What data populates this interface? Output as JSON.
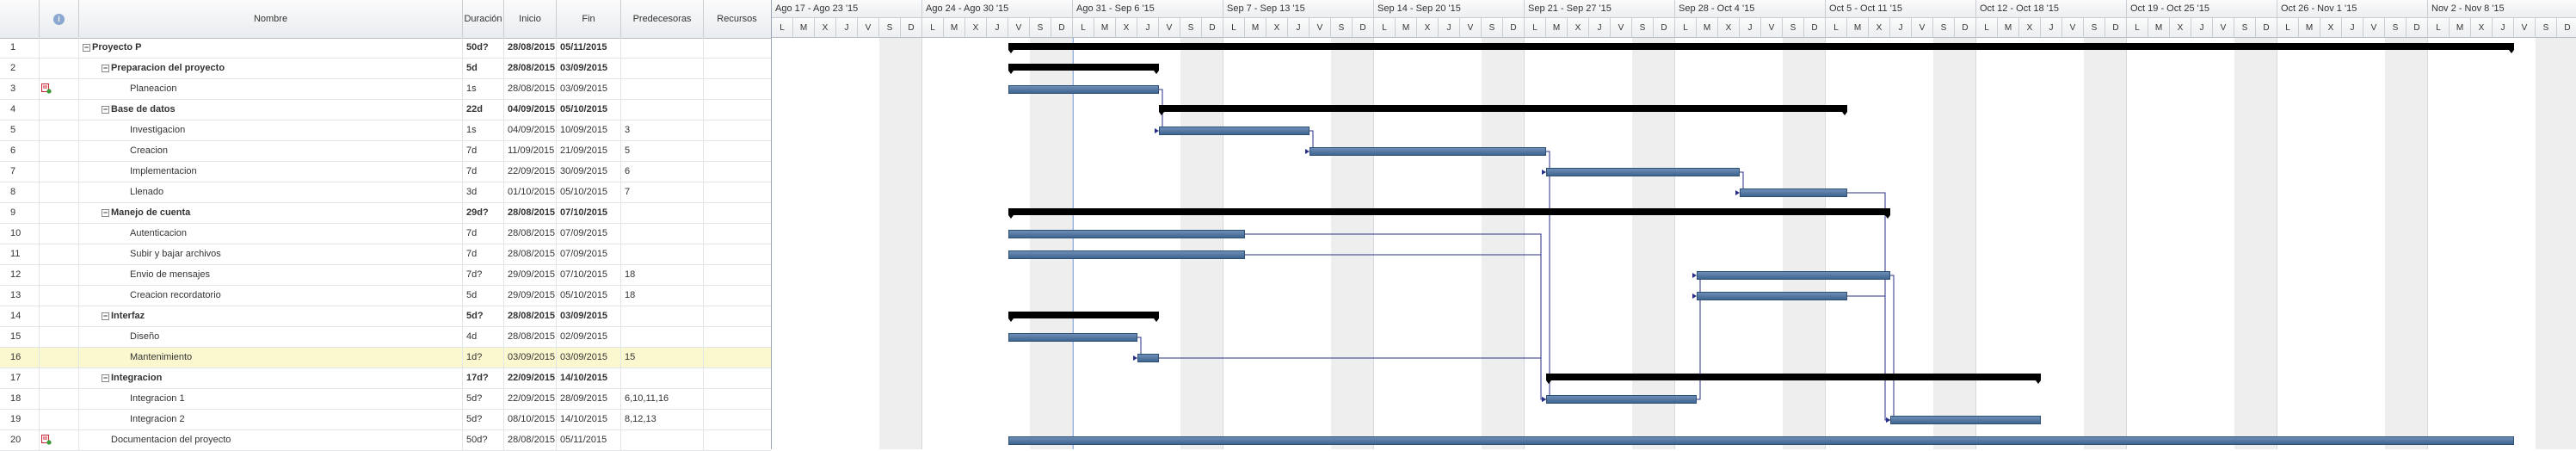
{
  "columns": {
    "info": "i",
    "name": "Nombre",
    "duration": "Duración",
    "start": "Inicio",
    "finish": "Fin",
    "predecessors": "Predecesoras",
    "resources": "Recursos"
  },
  "tasks": [
    {
      "id": "1",
      "name": "Proyecto P",
      "dur": "50d?",
      "start": "28/08/2015",
      "end": "05/11/2015",
      "pred": "",
      "res": "",
      "bold": true,
      "level": 0,
      "toggle": "⊟",
      "icon": ""
    },
    {
      "id": "2",
      "name": "Preparacion del proyecto",
      "dur": "5d",
      "start": "28/08/2015",
      "end": "03/09/2015",
      "pred": "",
      "res": "",
      "bold": true,
      "level": 1,
      "toggle": "⊟",
      "icon": ""
    },
    {
      "id": "3",
      "name": "Planeacion",
      "dur": "1s",
      "start": "28/08/2015",
      "end": "03/09/2015",
      "pred": "",
      "res": "",
      "bold": false,
      "level": 2,
      "toggle": "",
      "icon": "note"
    },
    {
      "id": "4",
      "name": "Base de datos",
      "dur": "22d",
      "start": "04/09/2015",
      "end": "05/10/2015",
      "pred": "",
      "res": "",
      "bold": true,
      "level": 1,
      "toggle": "⊟",
      "icon": ""
    },
    {
      "id": "5",
      "name": "Investigacion",
      "dur": "1s",
      "start": "04/09/2015",
      "end": "10/09/2015",
      "pred": "3",
      "res": "",
      "bold": false,
      "level": 2,
      "toggle": "",
      "icon": ""
    },
    {
      "id": "6",
      "name": "Creacion",
      "dur": "7d",
      "start": "11/09/2015",
      "end": "21/09/2015",
      "pred": "5",
      "res": "",
      "bold": false,
      "level": 2,
      "toggle": "",
      "icon": ""
    },
    {
      "id": "7",
      "name": "Implementacion",
      "dur": "7d",
      "start": "22/09/2015",
      "end": "30/09/2015",
      "pred": "6",
      "res": "",
      "bold": false,
      "level": 2,
      "toggle": "",
      "icon": ""
    },
    {
      "id": "8",
      "name": "Llenado",
      "dur": "3d",
      "start": "01/10/2015",
      "end": "05/10/2015",
      "pred": "7",
      "res": "",
      "bold": false,
      "level": 2,
      "toggle": "",
      "icon": ""
    },
    {
      "id": "9",
      "name": "Manejo de cuenta",
      "dur": "29d?",
      "start": "28/08/2015",
      "end": "07/10/2015",
      "pred": "",
      "res": "",
      "bold": true,
      "level": 1,
      "toggle": "⊟",
      "icon": ""
    },
    {
      "id": "10",
      "name": "Autenticacion",
      "dur": "7d",
      "start": "28/08/2015",
      "end": "07/09/2015",
      "pred": "",
      "res": "",
      "bold": false,
      "level": 2,
      "toggle": "",
      "icon": ""
    },
    {
      "id": "11",
      "name": "Subir y bajar archivos",
      "dur": "7d",
      "start": "28/08/2015",
      "end": "07/09/2015",
      "pred": "",
      "res": "",
      "bold": false,
      "level": 2,
      "toggle": "",
      "icon": ""
    },
    {
      "id": "12",
      "name": "Envio de mensajes",
      "dur": "7d?",
      "start": "29/09/2015",
      "end": "07/10/2015",
      "pred": "18",
      "res": "",
      "bold": false,
      "level": 2,
      "toggle": "",
      "icon": ""
    },
    {
      "id": "13",
      "name": "Creacion recordatorio",
      "dur": "5d",
      "start": "29/09/2015",
      "end": "05/10/2015",
      "pred": "18",
      "res": "",
      "bold": false,
      "level": 2,
      "toggle": "",
      "icon": ""
    },
    {
      "id": "14",
      "name": "Interfaz",
      "dur": "5d?",
      "start": "28/08/2015",
      "end": "03/09/2015",
      "pred": "",
      "res": "",
      "bold": true,
      "level": 1,
      "toggle": "⊟",
      "icon": ""
    },
    {
      "id": "15",
      "name": "Diseño",
      "dur": "4d",
      "start": "28/08/2015",
      "end": "02/09/2015",
      "pred": "",
      "res": "",
      "bold": false,
      "level": 2,
      "toggle": "",
      "icon": ""
    },
    {
      "id": "16",
      "name": "Mantenimiento",
      "dur": "1d?",
      "start": "03/09/2015",
      "end": "03/09/2015",
      "pred": "15",
      "res": "",
      "bold": false,
      "level": 2,
      "toggle": "",
      "icon": "",
      "selected": true
    },
    {
      "id": "17",
      "name": "Integracion",
      "dur": "17d?",
      "start": "22/09/2015",
      "end": "14/10/2015",
      "pred": "",
      "res": "",
      "bold": true,
      "level": 1,
      "toggle": "⊟",
      "icon": ""
    },
    {
      "id": "18",
      "name": "Integracion 1",
      "dur": "5d?",
      "start": "22/09/2015",
      "end": "28/09/2015",
      "pred": "6,10,11,16",
      "res": "",
      "bold": false,
      "level": 2,
      "toggle": "",
      "icon": ""
    },
    {
      "id": "19",
      "name": "Integracion 2",
      "dur": "5d?",
      "start": "08/10/2015",
      "end": "14/10/2015",
      "pred": "8,12,13",
      "res": "",
      "bold": false,
      "level": 2,
      "toggle": "",
      "icon": ""
    },
    {
      "id": "20",
      "name": "Documentacion del proyecto",
      "dur": "50d?",
      "start": "28/08/2015",
      "end": "05/11/2015",
      "pred": "",
      "res": "",
      "bold": false,
      "level": 1,
      "toggle": "",
      "icon": "note"
    }
  ],
  "timeline": {
    "weeks": [
      "Ago 17 - Ago 23 '15",
      "Ago 24 - Ago 30 '15",
      "Ago 31 - Sep 6 '15",
      "Sep 7 - Sep 13 '15",
      "Sep 14 - Sep 20 '15",
      "Sep 21 - Sep 27 '15",
      "Sep 28 - Oct 4 '15",
      "Oct 5 - Oct 11 '15",
      "Oct 12 - Oct 18 '15",
      "Oct 19 - Oct 25 '15",
      "Oct 26 - Nov 1 '15",
      "Nov 2 - Nov 8 '15"
    ],
    "day_letters": [
      "L",
      "M",
      "X",
      "J",
      "V",
      "S",
      "D"
    ],
    "first_day": "2015-08-17",
    "today": "2015-08-31"
  },
  "gantt": [
    {
      "row": 1,
      "type": "summary",
      "from": "2015-08-28",
      "to": "2015-11-05"
    },
    {
      "row": 2,
      "type": "summary",
      "from": "2015-08-28",
      "to": "2015-09-03"
    },
    {
      "row": 3,
      "type": "task",
      "from": "2015-08-28",
      "to": "2015-09-03"
    },
    {
      "row": 4,
      "type": "summary",
      "from": "2015-09-04",
      "to": "2015-10-05"
    },
    {
      "row": 5,
      "type": "task",
      "from": "2015-09-04",
      "to": "2015-09-10"
    },
    {
      "row": 6,
      "type": "task",
      "from": "2015-09-11",
      "to": "2015-09-21"
    },
    {
      "row": 7,
      "type": "task",
      "from": "2015-09-22",
      "to": "2015-09-30"
    },
    {
      "row": 8,
      "type": "task",
      "from": "2015-10-01",
      "to": "2015-10-05"
    },
    {
      "row": 9,
      "type": "summary",
      "from": "2015-08-28",
      "to": "2015-10-07"
    },
    {
      "row": 10,
      "type": "task",
      "from": "2015-08-28",
      "to": "2015-09-07"
    },
    {
      "row": 11,
      "type": "task",
      "from": "2015-08-28",
      "to": "2015-09-07"
    },
    {
      "row": 12,
      "type": "task",
      "from": "2015-09-29",
      "to": "2015-10-07"
    },
    {
      "row": 13,
      "type": "task",
      "from": "2015-09-29",
      "to": "2015-10-05"
    },
    {
      "row": 14,
      "type": "summary",
      "from": "2015-08-28",
      "to": "2015-09-03"
    },
    {
      "row": 15,
      "type": "task",
      "from": "2015-08-28",
      "to": "2015-09-02"
    },
    {
      "row": 16,
      "type": "task",
      "from": "2015-09-03",
      "to": "2015-09-03"
    },
    {
      "row": 17,
      "type": "summary",
      "from": "2015-09-22",
      "to": "2015-10-14"
    },
    {
      "row": 18,
      "type": "task",
      "from": "2015-09-22",
      "to": "2015-09-28"
    },
    {
      "row": 19,
      "type": "task",
      "from": "2015-10-08",
      "to": "2015-10-14"
    },
    {
      "row": 20,
      "type": "task",
      "from": "2015-08-28",
      "to": "2015-11-05"
    }
  ],
  "links": [
    [
      3,
      5
    ],
    [
      5,
      6
    ],
    [
      6,
      7
    ],
    [
      7,
      8
    ],
    [
      15,
      16
    ],
    [
      6,
      18
    ],
    [
      10,
      18
    ],
    [
      11,
      18
    ],
    [
      16,
      18
    ],
    [
      18,
      12
    ],
    [
      18,
      13
    ],
    [
      8,
      19
    ],
    [
      12,
      19
    ],
    [
      13,
      19
    ]
  ],
  "colors": {
    "bar": "#4f76a3",
    "summary": "#000000",
    "weekend": "#eeeeee",
    "selected_row": "#fbf7cf",
    "link": "#2a2f8a"
  }
}
